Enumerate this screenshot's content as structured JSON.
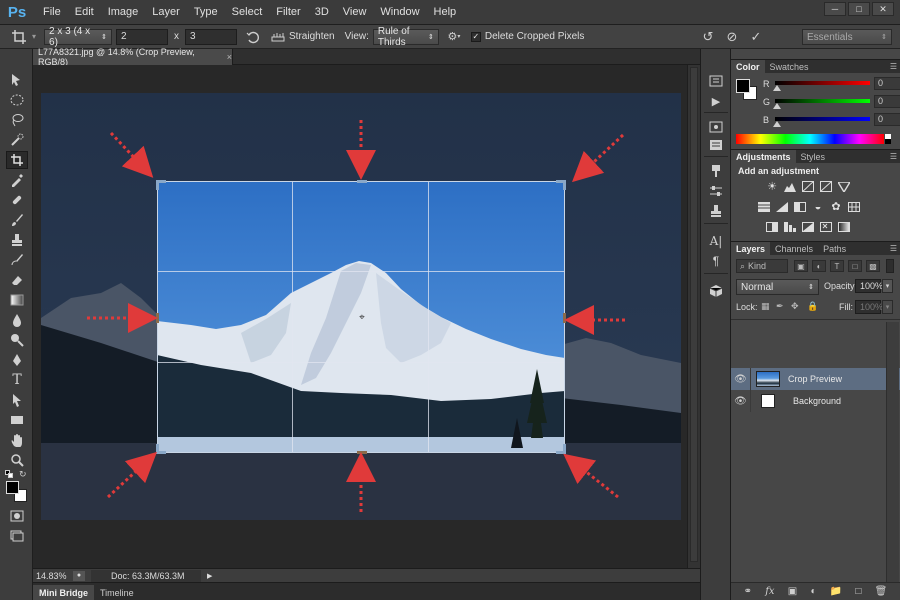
{
  "app": {
    "logo": "Ps",
    "menu": [
      "File",
      "Edit",
      "Image",
      "Layer",
      "Type",
      "Select",
      "Filter",
      "3D",
      "View",
      "Window",
      "Help"
    ],
    "window_controls": [
      "minimize",
      "maximize",
      "close"
    ]
  },
  "options_bar": {
    "ratio_preset": "2 x 3 (4 x 6)",
    "ratio_width": "2",
    "ratio_sep": "x",
    "ratio_height": "3",
    "straighten_label": "Straighten",
    "view_label": "View:",
    "view_value": "Rule of Thirds",
    "delete_cropped_label": "Delete Cropped Pixels",
    "delete_cropped_checked": true,
    "workspace": "Essentials"
  },
  "document": {
    "tab_title": "L77A8321.jpg @ 14.8% (Crop Preview, RGB/8)",
    "close_glyph": "×"
  },
  "status": {
    "zoom": "14.83%",
    "doc_info": "Doc: 63.3M/63.3M"
  },
  "bottom_tabs": [
    "Mini Bridge",
    "Timeline"
  ],
  "color_panel": {
    "tabs": [
      "Color",
      "Swatches"
    ],
    "sliders": [
      {
        "label": "R",
        "value": "0"
      },
      {
        "label": "G",
        "value": "0"
      },
      {
        "label": "B",
        "value": "0"
      }
    ]
  },
  "adjustments_panel": {
    "tabs": [
      "Adjustments",
      "Styles"
    ],
    "heading": "Add an adjustment"
  },
  "layers_panel": {
    "tabs": [
      "Layers",
      "Channels",
      "Paths"
    ],
    "filter_kind": "Kind",
    "blend_mode": "Normal",
    "opacity_label": "Opacity:",
    "opacity_value": "100%",
    "lock_label": "Lock:",
    "fill_label": "Fill:",
    "fill_value": "100%",
    "layers": [
      {
        "name": "Crop Preview",
        "selected": true
      },
      {
        "name": "Background",
        "selected": false
      }
    ]
  },
  "colors": {
    "accent": "#58b3f0",
    "arrow_red": "#e03a3a",
    "selected_layer": "#5d6d82"
  }
}
